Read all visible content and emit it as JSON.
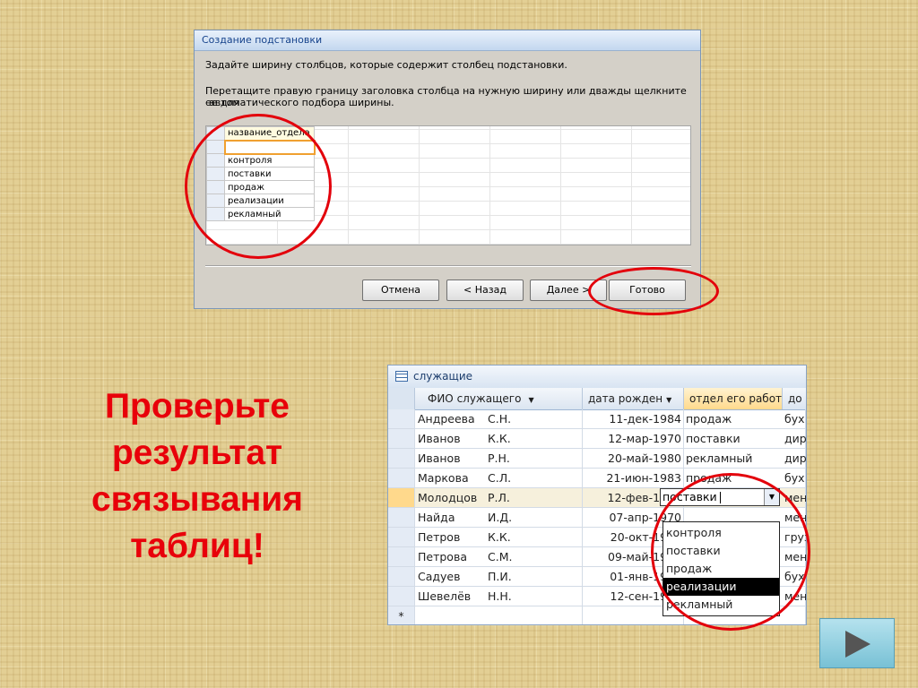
{
  "dialog": {
    "title": "Создание подстановки",
    "instruction1": "Задайте ширину столбцов, которые содержит столбец подстановки.",
    "instruction2_line1": "Перетащите правую границу заголовка столбца на нужную ширину или дважды щелкните ее для",
    "instruction2_line2": "автоматического подбора ширины.",
    "column_header": "название_отдела",
    "values": [
      "",
      "контроля",
      "поставки",
      "продаж",
      "реализации",
      "рекламный"
    ],
    "buttons": {
      "cancel": "Отмена",
      "back": "< Назад",
      "next": "Далее >",
      "finish": "Готово"
    }
  },
  "heading": {
    "line1": "Проверьте",
    "line2": "результат",
    "line3": "связывания",
    "line4": "таблиц!"
  },
  "table": {
    "title": "служащие",
    "columns": [
      "ФИО служащего",
      "дата рожден",
      "отдел его работ",
      "до"
    ],
    "rows": [
      {
        "surname": "Андреева",
        "initials": "С.Н.",
        "date": "11-дек-1984",
        "dept": "продаж",
        "extra": "бух"
      },
      {
        "surname": "Иванов",
        "initials": "К.К.",
        "date": "12-мар-1970",
        "dept": "поставки",
        "extra": "дир"
      },
      {
        "surname": "Иванов",
        "initials": "Р.Н.",
        "date": "20-май-1980",
        "dept": "рекламный",
        "extra": "дир"
      },
      {
        "surname": "Маркова",
        "initials": "С.Л.",
        "date": "21-июн-1983",
        "dept": "продаж",
        "extra": "бух"
      },
      {
        "surname": "Молодцов",
        "initials": "Р.Л.",
        "date": "12-фев-1970",
        "dept": "поставки",
        "extra": "мен"
      },
      {
        "surname": "Найда",
        "initials": "И.Д.",
        "date": "07-апр-1970",
        "dept": "",
        "extra": "мен"
      },
      {
        "surname": "Петров",
        "initials": "К.К.",
        "date": "20-окт-1980",
        "dept": "",
        "extra": "груз"
      },
      {
        "surname": "Петрова",
        "initials": "С.М.",
        "date": "09-май-1981",
        "dept": "",
        "extra": "мен"
      },
      {
        "surname": "Садуев",
        "initials": "П.И.",
        "date": "01-янв-1969",
        "dept": "",
        "extra": "бух"
      },
      {
        "surname": "Шевелёв",
        "initials": "Н.Н.",
        "date": "12-сен-1963",
        "dept": "",
        "extra": "мен"
      }
    ],
    "new_row_marker": "*",
    "edit_value": "поставки",
    "dropdown_items": [
      "контроля",
      "поставки",
      "продаж",
      "реализации",
      "рекламный"
    ],
    "dropdown_selected": "реализации"
  },
  "colors": {
    "heading": "#e8000a",
    "highlight_circle": "#e3000b",
    "background": "#e3cf94"
  },
  "icons": {
    "next_slide": "play-triangle-icon",
    "table": "table-icon"
  }
}
